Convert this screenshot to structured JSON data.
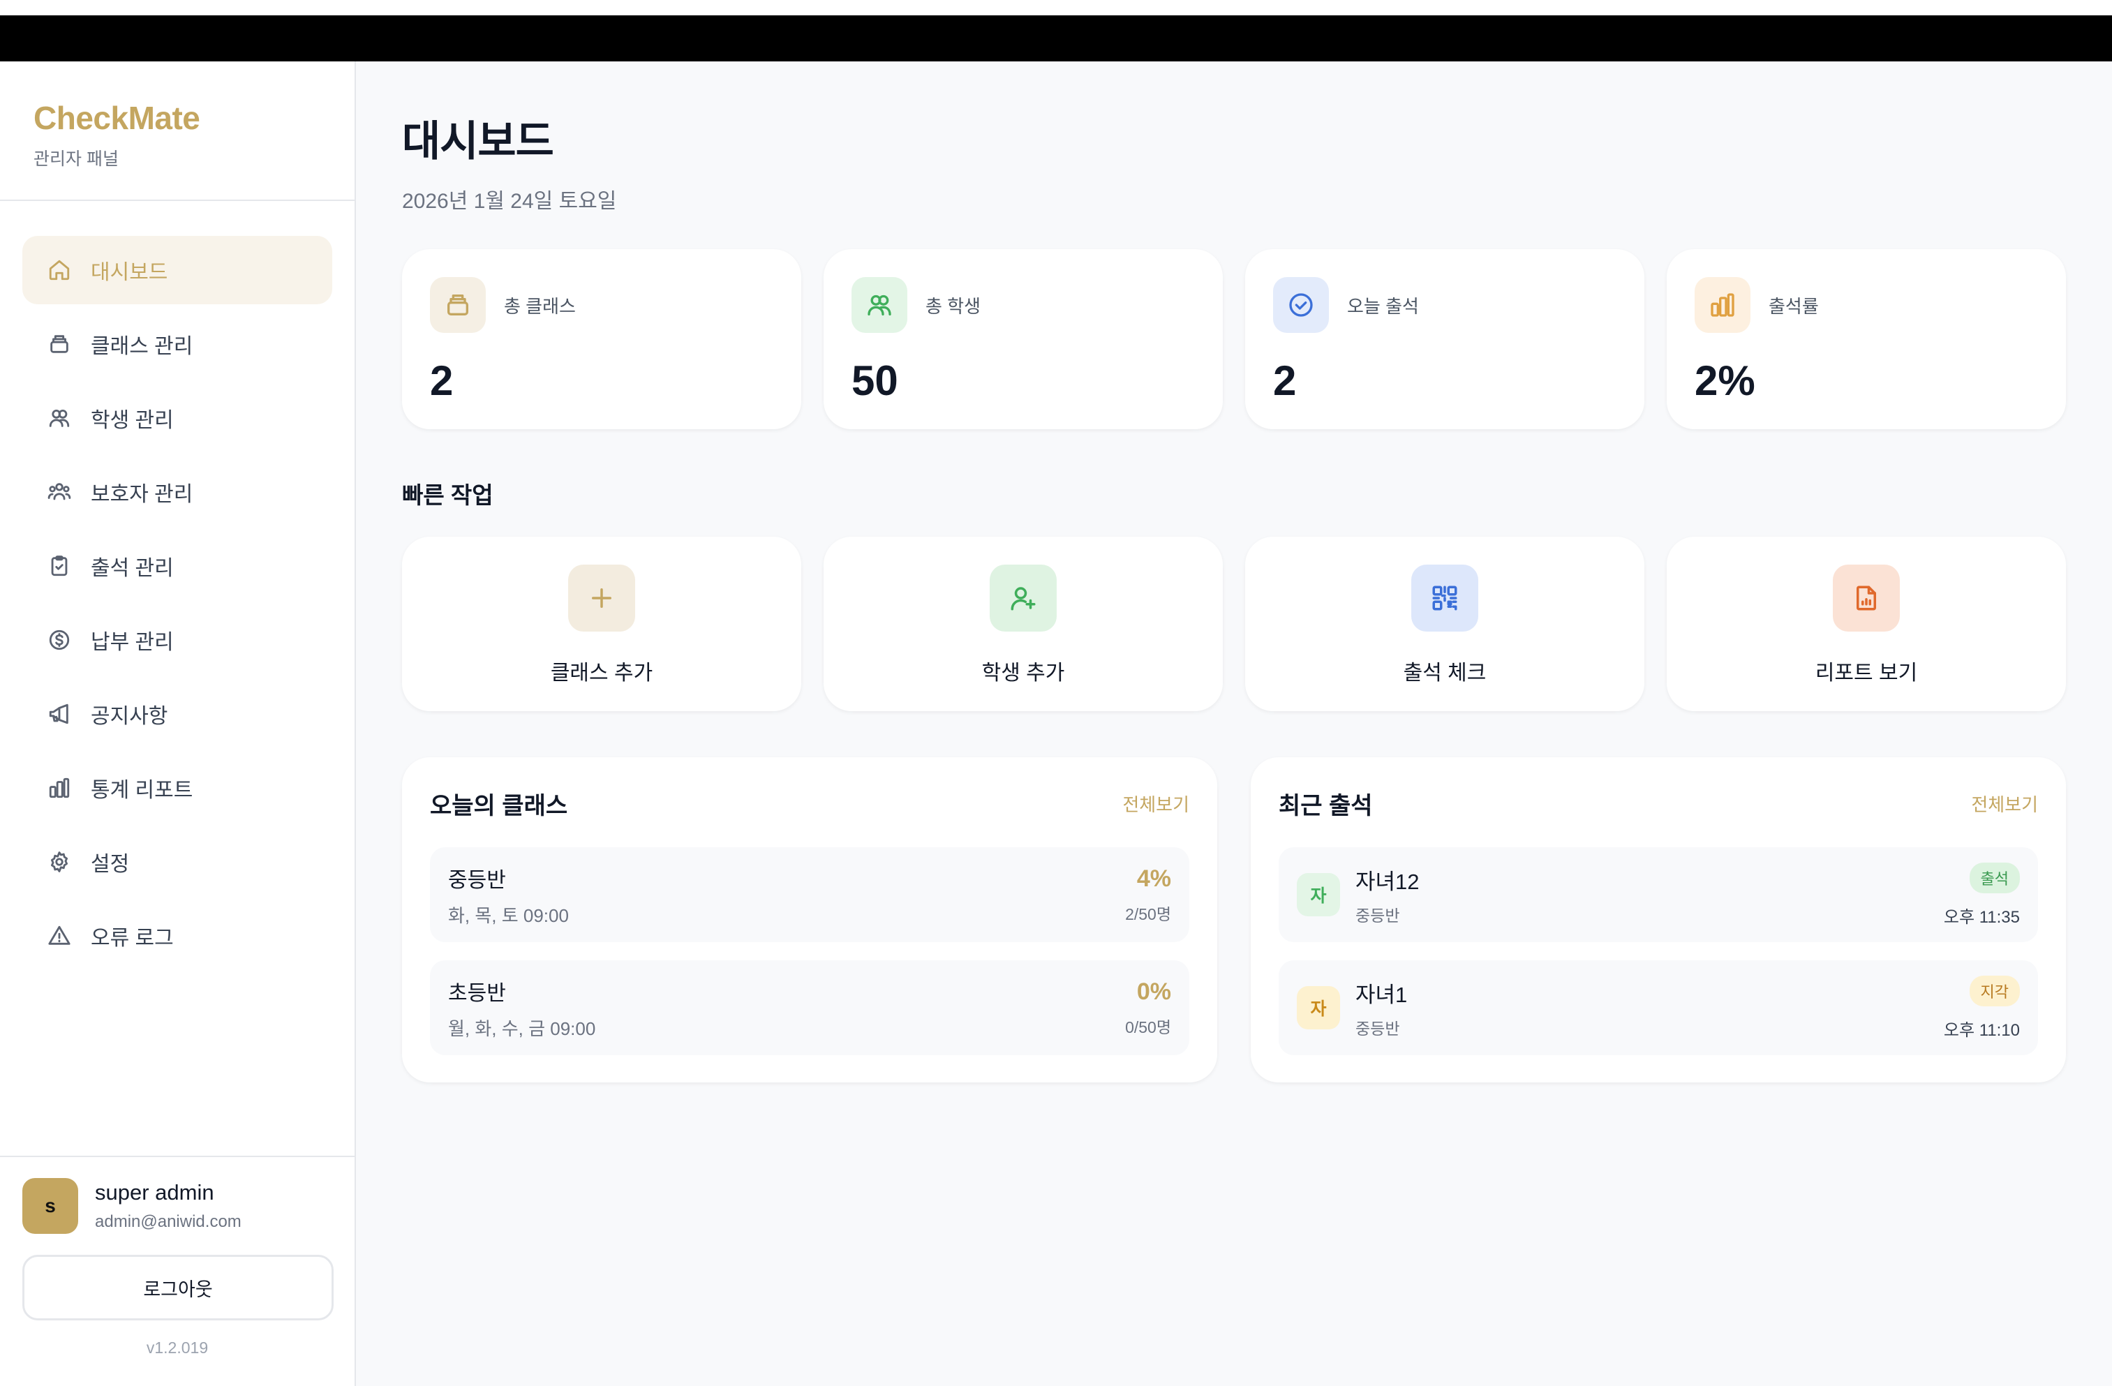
{
  "brand": {
    "title": "CheckMate",
    "subtitle": "관리자 패널"
  },
  "sidebar": {
    "items": [
      {
        "label": "대시보드",
        "icon": "home-icon",
        "active": true
      },
      {
        "label": "클래스 관리",
        "icon": "class-stack-icon",
        "active": false
      },
      {
        "label": "학생 관리",
        "icon": "students-icon",
        "active": false
      },
      {
        "label": "보호자 관리",
        "icon": "guardians-icon",
        "active": false
      },
      {
        "label": "출석 관리",
        "icon": "clipboard-check-icon",
        "active": false
      },
      {
        "label": "납부 관리",
        "icon": "dollar-circle-icon",
        "active": false
      },
      {
        "label": "공지사항",
        "icon": "megaphone-icon",
        "active": false
      },
      {
        "label": "통계 리포트",
        "icon": "bar-chart-icon",
        "active": false
      },
      {
        "label": "설정",
        "icon": "gear-icon",
        "active": false
      },
      {
        "label": "오류 로그",
        "icon": "warning-triangle-icon",
        "active": false
      }
    ]
  },
  "user": {
    "initial": "s",
    "name": "super admin",
    "email": "admin@aniwid.com",
    "logout_label": "로그아웃",
    "version": "v1.2.019"
  },
  "page": {
    "title": "대시보드",
    "date": "2026년 1월 24일 토요일"
  },
  "stats": [
    {
      "label": "총 클래스",
      "value": "2",
      "icon": "class-stack-icon",
      "bg": "#f5efe4",
      "color": "#c4a660"
    },
    {
      "label": "총 학생",
      "value": "50",
      "icon": "students-icon",
      "bg": "#e3f5e6",
      "color": "#3fae5a"
    },
    {
      "label": "오늘 출석",
      "value": "2",
      "icon": "check-circle-icon",
      "bg": "#e3ebfb",
      "color": "#3b6fd8"
    },
    {
      "label": "출석률",
      "value": "2%",
      "icon": "bar-chart-icon",
      "bg": "#fdf0e0",
      "color": "#e0a040"
    }
  ],
  "quick": {
    "title": "빠른 작업",
    "actions": [
      {
        "label": "클래스 추가",
        "icon": "plus-icon",
        "bg": "#f3ecdf",
        "color": "#c4a660"
      },
      {
        "label": "학생 추가",
        "icon": "user-plus-icon",
        "bg": "#dff3e2",
        "color": "#3fae5a"
      },
      {
        "label": "출석 체크",
        "icon": "qr-code-icon",
        "bg": "#dde7fb",
        "color": "#3b6fd8"
      },
      {
        "label": "리포트 보기",
        "icon": "report-file-icon",
        "bg": "#fbe2d5",
        "color": "#e0692c"
      }
    ]
  },
  "today_classes": {
    "title": "오늘의 클래스",
    "link": "전체보기",
    "rows": [
      {
        "name": "중등반",
        "schedule": "화, 목, 토 09:00",
        "rate": "4%",
        "count": "2/50명"
      },
      {
        "name": "초등반",
        "schedule": "월, 화, 수, 금 09:00",
        "rate": "0%",
        "count": "0/50명"
      }
    ]
  },
  "recent_attendance": {
    "title": "최근 출석",
    "link": "전체보기",
    "rows": [
      {
        "initial": "자",
        "name": "자녀12",
        "class": "중등반",
        "status": "출석",
        "time": "오후 11:35",
        "avatar_bg": "#e3f5e6",
        "avatar_color": "#3fae5a",
        "badge_bg": "#dcf3df",
        "badge_color": "#3a9a50"
      },
      {
        "initial": "자",
        "name": "자녀1",
        "class": "중등반",
        "status": "지각",
        "time": "오후 11:10",
        "avatar_bg": "#fdf1cf",
        "avatar_color": "#c98a1a",
        "badge_bg": "#fdf1cf",
        "badge_color": "#b7791f"
      }
    ]
  }
}
